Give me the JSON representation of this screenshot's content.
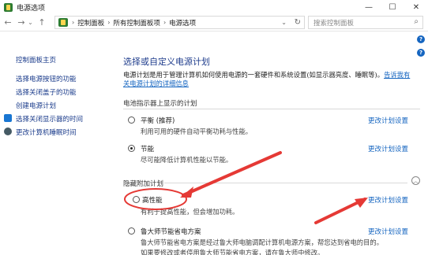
{
  "window": {
    "title": "电源选项",
    "minimize": "—",
    "maximize": "☐",
    "close": "✕"
  },
  "nav": {
    "back": "←",
    "forward": "→",
    "up": "↑",
    "dropdown": "⌄",
    "breadcrumbs": [
      "控制面板",
      "所有控制面板项",
      "电源选项"
    ],
    "separator": "›",
    "refresh": "↻",
    "search_placeholder": "搜索控制面板"
  },
  "sidebar": {
    "items": [
      {
        "label": "控制面板主页"
      },
      {
        "label": "选择电源按钮的功能"
      },
      {
        "label": "选择关闭盖子的功能"
      },
      {
        "label": "创建电源计划"
      },
      {
        "label": "选择关闭显示器的时间"
      },
      {
        "label": "更改计算机睡眠时间"
      }
    ]
  },
  "main": {
    "heading": "选择或自定义电源计划",
    "description": "电源计划是用于管理计算机如何使用电源的一套硬件和系统设置(如显示器亮度、睡眠等)。",
    "description_link": "告诉我有关电源计划的详细信息",
    "section_battery": "电池指示器上显示的计划",
    "section_hidden": "隐藏附加计划",
    "collapse": "︿",
    "change_link": "更改计划设置",
    "plans": [
      {
        "name": "平衡 (推荐)",
        "desc": "利用可用的硬件自动平衡功耗与性能。",
        "checked": false
      },
      {
        "name": "节能",
        "desc": "尽可能降低计算机性能以节能。",
        "checked": true
      },
      {
        "name": "高性能",
        "desc": "有利于提高性能，但会增加功耗。",
        "checked": false
      },
      {
        "name": "鲁大师节能省电方案",
        "desc": "鲁大师节能省电方案是经过鲁大师电脑调配计算机电源方案，帮您达到省电的目的。",
        "desc2": "如果要修改或者停用鲁大师节能省电方案，请在鲁大师中修改。",
        "checked": false
      }
    ]
  },
  "help": "?",
  "colors": {
    "link": "#1565c0",
    "heading": "#1e3c8c",
    "annotation": "#e53935"
  }
}
